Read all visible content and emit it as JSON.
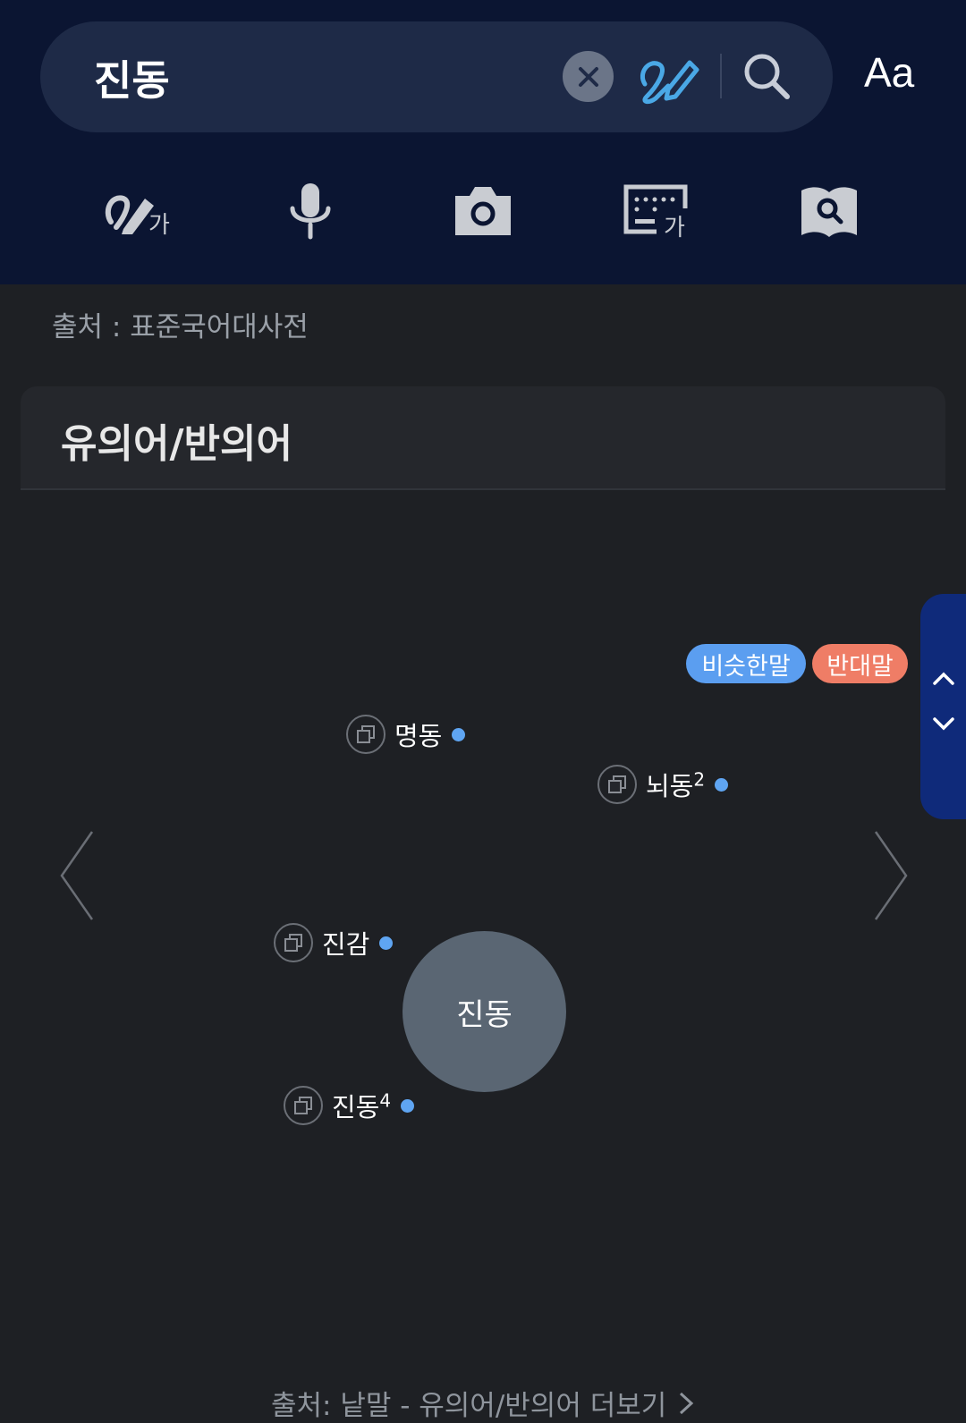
{
  "search": {
    "query": "진동"
  },
  "header": {
    "font_button": "Aa"
  },
  "tools": [
    {
      "icon": "handwriting-input-icon",
      "text": "가"
    },
    {
      "icon": "microphone-icon"
    },
    {
      "icon": "camera-icon"
    },
    {
      "icon": "keyboard-input-icon",
      "text": "가"
    },
    {
      "icon": "book-search-icon"
    }
  ],
  "source_line": "출처 : 표준국어대사전",
  "synonym_card": {
    "title": "유의어/반의어",
    "legend": {
      "synonym": "비슷한말",
      "antonym": "반대말"
    },
    "center_word": "진동",
    "nodes": [
      {
        "word": "명동",
        "sup": "",
        "type": "synonym"
      },
      {
        "word": "뇌동",
        "sup": "2",
        "type": "synonym"
      },
      {
        "word": "진감",
        "sup": "",
        "type": "synonym"
      },
      {
        "word": "진동",
        "sup": "4",
        "type": "synonym"
      }
    ],
    "more_link": "출처: 낱말 - 유의어/반의어 더보기"
  },
  "colors": {
    "header_bg": "#0b1532",
    "synonym": "#5b9ef0",
    "antonym": "#ef7d66",
    "center_node": "#5a6673",
    "side_scroller": "#0f2a7a"
  }
}
